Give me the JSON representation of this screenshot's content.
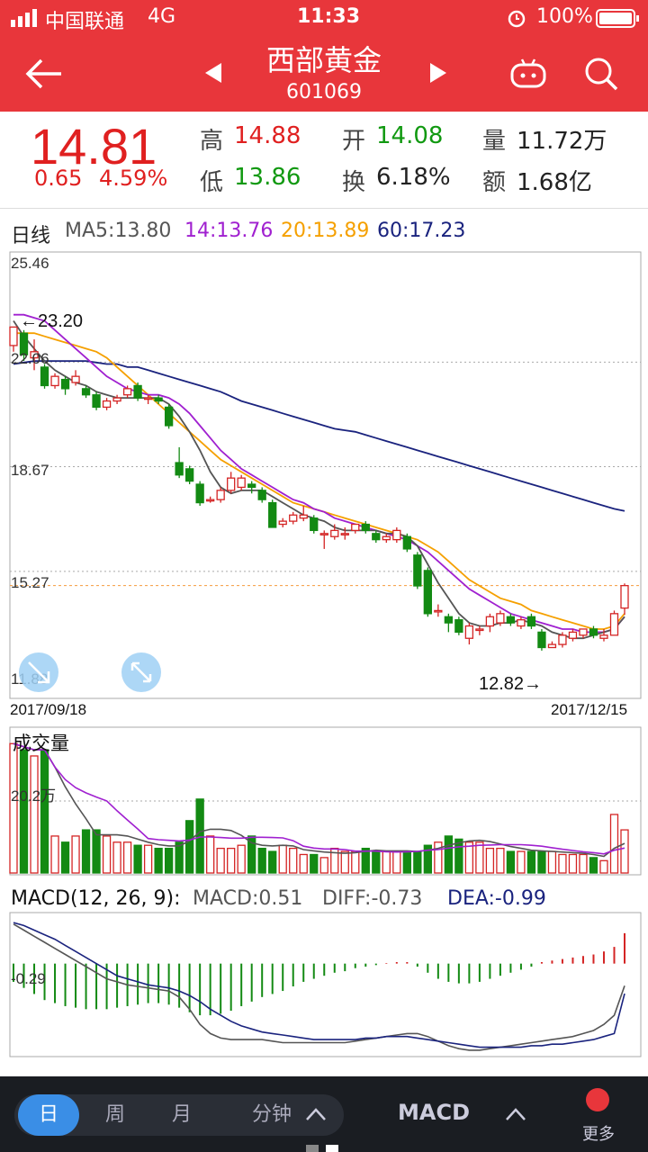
{
  "status": {
    "carrier": "中国联通",
    "network": "4G",
    "time": "11:33",
    "battery": "100%"
  },
  "header": {
    "name": "西部黄金",
    "code": "601069"
  },
  "quote": {
    "price": "14.81",
    "change": "0.65",
    "change_pct": "4.59%",
    "high_label": "高",
    "high": "14.88",
    "low_label": "低",
    "low": "13.86",
    "open_label": "开",
    "open": "14.08",
    "turnover_label": "换",
    "turnover": "6.18%",
    "volume_label": "量",
    "volume": "11.72万",
    "amount_label": "额",
    "amount": "1.68亿"
  },
  "ma_legend": {
    "period": "日线",
    "ma5": "MA5:13.80",
    "ma14": "14:13.76",
    "ma20": "20:13.89",
    "ma60": "60:17.23"
  },
  "colors": {
    "up": "#d42424",
    "down": "#138a13",
    "ma5": "#555555",
    "ma14": "#a020d0",
    "ma20": "#f5a000",
    "ma60": "#1a237e",
    "brand": "#e8363b"
  },
  "kchart": {
    "y_labels": [
      "25.46",
      "22.06",
      "18.67",
      "15.27",
      "11.88"
    ],
    "start_date": "2017/09/18",
    "end_date": "2017/12/15",
    "max_note": "←23.20",
    "min_note": "12.82→"
  },
  "volume": {
    "title": "成交量",
    "label": "20.2万"
  },
  "macd": {
    "title": "MACD(12, 26, 9):",
    "macd": "MACD:0.51",
    "diff": "DIFF:-0.73",
    "dea": "DEA:-0.99",
    "label": "-0.29"
  },
  "bottom": {
    "tabs": [
      "日",
      "周",
      "月",
      "分钟"
    ],
    "indicator": "MACD",
    "more": "更多"
  },
  "chart_data": [
    {
      "type": "candlestick",
      "ylim": [
        11.88,
        25.46
      ],
      "x_range": [
        "2017/09/18",
        "2017/12/15"
      ],
      "candles": [
        {
          "o": 22.6,
          "c": 23.2,
          "h": 23.2,
          "l": 22.4
        },
        {
          "o": 23.0,
          "c": 22.3,
          "h": 23.1,
          "l": 22.1
        },
        {
          "o": 22.2,
          "c": 22.4,
          "h": 22.8,
          "l": 21.8
        },
        {
          "o": 21.9,
          "c": 21.3,
          "h": 22.0,
          "l": 21.2
        },
        {
          "o": 21.3,
          "c": 21.6,
          "h": 21.7,
          "l": 21.2
        },
        {
          "o": 21.5,
          "c": 21.2,
          "h": 21.6,
          "l": 21.0
        },
        {
          "o": 21.4,
          "c": 21.6,
          "h": 21.8,
          "l": 21.3
        },
        {
          "o": 21.2,
          "c": 21.0,
          "h": 21.3,
          "l": 20.9
        },
        {
          "o": 21.0,
          "c": 20.6,
          "h": 21.1,
          "l": 20.5
        },
        {
          "o": 20.6,
          "c": 20.8,
          "h": 20.9,
          "l": 20.5
        },
        {
          "o": 20.8,
          "c": 20.9,
          "h": 21.0,
          "l": 20.7
        },
        {
          "o": 21.0,
          "c": 21.2,
          "h": 21.3,
          "l": 20.9
        },
        {
          "o": 21.3,
          "c": 20.9,
          "h": 21.4,
          "l": 20.8
        },
        {
          "o": 20.9,
          "c": 20.9,
          "h": 21.0,
          "l": 20.7
        },
        {
          "o": 20.9,
          "c": 20.8,
          "h": 21.0,
          "l": 20.7
        },
        {
          "o": 20.6,
          "c": 20.0,
          "h": 20.7,
          "l": 19.9
        },
        {
          "o": 18.8,
          "c": 18.4,
          "h": 19.3,
          "l": 18.3
        },
        {
          "o": 18.6,
          "c": 18.2,
          "h": 18.7,
          "l": 18.1
        },
        {
          "o": 18.1,
          "c": 17.5,
          "h": 18.2,
          "l": 17.4
        },
        {
          "o": 17.6,
          "c": 17.6,
          "h": 17.7,
          "l": 17.5
        },
        {
          "o": 17.6,
          "c": 17.9,
          "h": 18.0,
          "l": 17.5
        },
        {
          "o": 17.9,
          "c": 18.3,
          "h": 18.5,
          "l": 17.8
        },
        {
          "o": 18.0,
          "c": 18.3,
          "h": 18.4,
          "l": 17.9
        },
        {
          "o": 18.1,
          "c": 18.0,
          "h": 18.2,
          "l": 17.8
        },
        {
          "o": 17.9,
          "c": 17.6,
          "h": 18.0,
          "l": 17.5
        },
        {
          "o": 17.5,
          "c": 16.7,
          "h": 17.6,
          "l": 16.7
        },
        {
          "o": 16.8,
          "c": 16.9,
          "h": 17.0,
          "l": 16.7
        },
        {
          "o": 16.9,
          "c": 17.1,
          "h": 17.2,
          "l": 16.8
        },
        {
          "o": 17.0,
          "c": 17.1,
          "h": 17.4,
          "l": 16.9
        },
        {
          "o": 17.0,
          "c": 16.6,
          "h": 17.1,
          "l": 16.5
        },
        {
          "o": 16.5,
          "c": 16.5,
          "h": 16.6,
          "l": 16.0
        },
        {
          "o": 16.4,
          "c": 16.6,
          "h": 16.8,
          "l": 16.3
        },
        {
          "o": 16.5,
          "c": 16.5,
          "h": 16.7,
          "l": 16.3
        },
        {
          "o": 16.6,
          "c": 16.8,
          "h": 16.8,
          "l": 16.5
        },
        {
          "o": 16.8,
          "c": 16.6,
          "h": 16.9,
          "l": 16.5
        },
        {
          "o": 16.5,
          "c": 16.3,
          "h": 16.6,
          "l": 16.2
        },
        {
          "o": 16.3,
          "c": 16.4,
          "h": 16.5,
          "l": 16.2
        },
        {
          "o": 16.3,
          "c": 16.6,
          "h": 16.7,
          "l": 16.2
        },
        {
          "o": 16.4,
          "c": 16.0,
          "h": 16.5,
          "l": 15.9
        },
        {
          "o": 15.8,
          "c": 14.8,
          "h": 15.9,
          "l": 14.7
        },
        {
          "o": 15.3,
          "c": 13.9,
          "h": 15.4,
          "l": 13.8
        },
        {
          "o": 14.0,
          "c": 14.0,
          "h": 14.2,
          "l": 13.8
        },
        {
          "o": 13.8,
          "c": 13.6,
          "h": 13.9,
          "l": 13.3
        },
        {
          "o": 13.7,
          "c": 13.3,
          "h": 13.8,
          "l": 13.2
        },
        {
          "o": 13.1,
          "c": 13.5,
          "h": 13.6,
          "l": 12.9
        },
        {
          "o": 13.4,
          "c": 13.4,
          "h": 13.5,
          "l": 13.2
        },
        {
          "o": 13.5,
          "c": 13.8,
          "h": 13.9,
          "l": 13.3
        },
        {
          "o": 13.6,
          "c": 13.9,
          "h": 14.0,
          "l": 13.5
        },
        {
          "o": 13.8,
          "c": 13.6,
          "h": 13.9,
          "l": 13.5
        },
        {
          "o": 13.5,
          "c": 13.7,
          "h": 13.8,
          "l": 13.4
        },
        {
          "o": 13.8,
          "c": 13.5,
          "h": 13.9,
          "l": 13.4
        },
        {
          "o": 13.3,
          "c": 12.8,
          "h": 13.4,
          "l": 12.7
        },
        {
          "o": 12.8,
          "c": 12.9,
          "h": 13.0,
          "l": 12.82
        },
        {
          "o": 12.9,
          "c": 13.2,
          "h": 13.3,
          "l": 12.8
        },
        {
          "o": 13.1,
          "c": 13.3,
          "h": 13.4,
          "l": 13.0
        },
        {
          "o": 13.2,
          "c": 13.4,
          "h": 13.4,
          "l": 13.1
        },
        {
          "o": 13.4,
          "c": 13.2,
          "h": 13.5,
          "l": 13.1
        },
        {
          "o": 13.1,
          "c": 13.2,
          "h": 13.4,
          "l": 13.0
        },
        {
          "o": 13.2,
          "c": 13.9,
          "h": 14.0,
          "l": 13.2
        },
        {
          "o": 14.08,
          "c": 14.81,
          "h": 14.88,
          "l": 13.86
        }
      ],
      "ma5": [
        23.4,
        22.9,
        22.5,
        22.1,
        21.8,
        21.6,
        21.4,
        21.3,
        21.1,
        21.0,
        20.9,
        20.9,
        20.9,
        20.9,
        20.9,
        20.7,
        20.3,
        19.8,
        19.2,
        18.5,
        18.0,
        17.8,
        17.9,
        17.9,
        17.9,
        17.7,
        17.5,
        17.3,
        17.1,
        17.0,
        16.9,
        16.7,
        16.6,
        16.6,
        16.6,
        16.6,
        16.5,
        16.5,
        16.4,
        16.1,
        15.5,
        14.9,
        14.4,
        13.9,
        13.6,
        13.5,
        13.5,
        13.6,
        13.6,
        13.7,
        13.6,
        13.5,
        13.3,
        13.2,
        13.1,
        13.1,
        13.2,
        13.3,
        13.4,
        13.8
      ],
      "ma14": [
        23.6,
        23.6,
        23.5,
        23.4,
        23.1,
        22.8,
        22.5,
        22.2,
        21.9,
        21.6,
        21.4,
        21.2,
        21.1,
        21.0,
        21.0,
        20.9,
        20.7,
        20.4,
        20.0,
        19.6,
        19.2,
        18.9,
        18.6,
        18.4,
        18.2,
        18.0,
        17.8,
        17.6,
        17.5,
        17.3,
        17.2,
        17.0,
        16.9,
        16.8,
        16.7,
        16.6,
        16.5,
        16.4,
        16.3,
        16.1,
        15.9,
        15.6,
        15.3,
        15.0,
        14.7,
        14.5,
        14.3,
        14.1,
        13.9,
        13.8,
        13.7,
        13.6,
        13.5,
        13.4,
        13.4,
        13.3,
        13.3,
        13.3,
        13.4,
        13.8
      ],
      "ma20": [
        23.0,
        23.0,
        23.0,
        22.9,
        22.8,
        22.7,
        22.6,
        22.5,
        22.4,
        22.2,
        21.9,
        21.6,
        21.3,
        21.0,
        20.7,
        20.4,
        20.1,
        19.8,
        19.5,
        19.2,
        18.9,
        18.7,
        18.5,
        18.3,
        18.1,
        17.9,
        17.7,
        17.5,
        17.4,
        17.3,
        17.2,
        17.1,
        17.0,
        16.9,
        16.8,
        16.7,
        16.6,
        16.5,
        16.4,
        16.3,
        16.1,
        15.9,
        15.6,
        15.3,
        15.0,
        14.8,
        14.6,
        14.4,
        14.3,
        14.2,
        14.0,
        13.9,
        13.8,
        13.7,
        13.6,
        13.5,
        13.4,
        13.4,
        13.5,
        13.9
      ],
      "ma60": [
        22.0,
        22.05,
        22.1,
        22.1,
        22.1,
        22.1,
        22.1,
        22.1,
        22.05,
        22.0,
        22.0,
        21.9,
        21.9,
        21.8,
        21.7,
        21.6,
        21.5,
        21.4,
        21.3,
        21.2,
        21.1,
        20.95,
        20.8,
        20.7,
        20.6,
        20.5,
        20.4,
        20.3,
        20.2,
        20.1,
        20.0,
        19.9,
        19.85,
        19.8,
        19.7,
        19.6,
        19.5,
        19.4,
        19.3,
        19.2,
        19.1,
        19.0,
        18.9,
        18.8,
        18.7,
        18.6,
        18.5,
        18.4,
        18.3,
        18.2,
        18.1,
        18.0,
        17.9,
        17.8,
        17.7,
        17.6,
        17.5,
        17.4,
        17.3,
        17.23
      ]
    },
    {
      "type": "bar",
      "title": "成交量",
      "unit": "万",
      "values": [
        42,
        40,
        38,
        40,
        12,
        10,
        12,
        14,
        14,
        12,
        10,
        10,
        9,
        9,
        8,
        8,
        10,
        17,
        24,
        12,
        8,
        8,
        9,
        12,
        8,
        7,
        9,
        8,
        6,
        6,
        5,
        8,
        7,
        7,
        8,
        7,
        7,
        7,
        7,
        7,
        9,
        10,
        12,
        11,
        10,
        10,
        8,
        8,
        7,
        7,
        7,
        7,
        7,
        6,
        6,
        6,
        5,
        4,
        19,
        14
      ],
      "ylim": [
        0,
        45
      ]
    },
    {
      "type": "macd",
      "hist": [
        -0.6,
        -0.8,
        -1.0,
        -1.2,
        -1.3,
        -1.4,
        -1.45,
        -1.5,
        -1.5,
        -1.5,
        -1.45,
        -1.4,
        -1.35,
        -1.3,
        -1.3,
        -1.35,
        -1.45,
        -1.6,
        -1.7,
        -1.7,
        -1.65,
        -1.55,
        -1.4,
        -1.25,
        -1.1,
        -1.0,
        -0.9,
        -0.75,
        -0.6,
        -0.5,
        -0.4,
        -0.3,
        -0.25,
        -0.15,
        -0.1,
        -0.05,
        0.02,
        0.05,
        0.05,
        -0.1,
        -0.3,
        -0.5,
        -0.6,
        -0.65,
        -0.65,
        -0.6,
        -0.5,
        -0.4,
        -0.3,
        -0.2,
        -0.1,
        0.05,
        0.1,
        0.15,
        0.2,
        0.25,
        0.3,
        0.4,
        0.55,
        1.0
      ],
      "diff": [
        1.3,
        1.1,
        0.9,
        0.7,
        0.5,
        0.3,
        0.1,
        -0.1,
        -0.3,
        -0.5,
        -0.6,
        -0.7,
        -0.75,
        -0.8,
        -0.85,
        -0.9,
        -1.1,
        -1.5,
        -2.0,
        -2.3,
        -2.45,
        -2.5,
        -2.5,
        -2.5,
        -2.5,
        -2.55,
        -2.6,
        -2.6,
        -2.6,
        -2.6,
        -2.6,
        -2.6,
        -2.6,
        -2.55,
        -2.5,
        -2.45,
        -2.4,
        -2.35,
        -2.3,
        -2.3,
        -2.4,
        -2.55,
        -2.7,
        -2.8,
        -2.85,
        -2.85,
        -2.8,
        -2.75,
        -2.7,
        -2.65,
        -2.6,
        -2.55,
        -2.5,
        -2.45,
        -2.4,
        -2.3,
        -2.2,
        -2.0,
        -1.7,
        -0.73
      ],
      "dea": [
        1.35,
        1.25,
        1.1,
        0.95,
        0.8,
        0.6,
        0.4,
        0.2,
        0.0,
        -0.2,
        -0.4,
        -0.5,
        -0.6,
        -0.7,
        -0.75,
        -0.8,
        -0.9,
        -1.05,
        -1.25,
        -1.5,
        -1.7,
        -1.9,
        -2.05,
        -2.15,
        -2.25,
        -2.3,
        -2.35,
        -2.4,
        -2.45,
        -2.5,
        -2.5,
        -2.5,
        -2.5,
        -2.5,
        -2.45,
        -2.45,
        -2.4,
        -2.4,
        -2.4,
        -2.45,
        -2.5,
        -2.55,
        -2.6,
        -2.65,
        -2.7,
        -2.75,
        -2.75,
        -2.75,
        -2.75,
        -2.75,
        -2.7,
        -2.7,
        -2.65,
        -2.65,
        -2.6,
        -2.55,
        -2.5,
        -2.4,
        -2.3,
        -0.99
      ],
      "ylim": [
        -3.0,
        1.5
      ]
    }
  ]
}
